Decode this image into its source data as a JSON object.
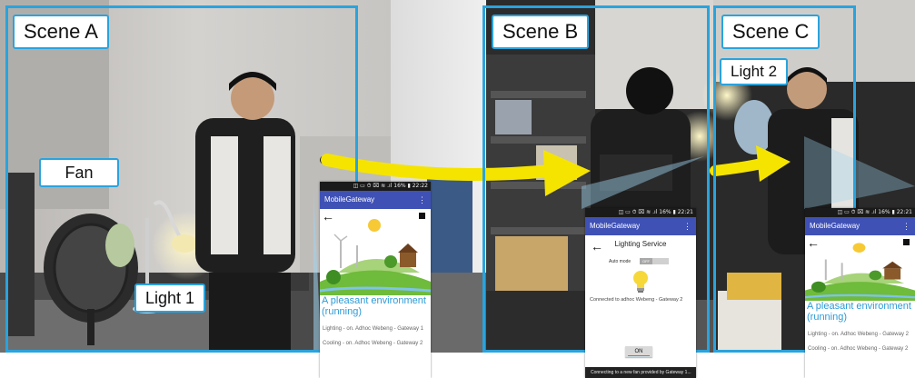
{
  "scenes": {
    "a": {
      "label": "Scene A"
    },
    "b": {
      "label": "Scene B"
    },
    "c": {
      "label": "Scene C"
    }
  },
  "callouts": {
    "fan": "Fan",
    "light1": "Light 1",
    "light2": "Light 2"
  },
  "colors": {
    "frame": "#2aa3dd",
    "arrow": "#f5e400",
    "appbar": "#3f51b5",
    "heading": "#2e9bd6"
  },
  "phones": {
    "a": {
      "status": "◫ ▭    ⏱ ⌧ ≋ .ıl 16% ▮ 22:22",
      "app_title": "MobileGateway",
      "menu_icon": "more-vertical-icon",
      "heading": "A pleasant environment (running)",
      "lines": [
        "Lighting - on. Adhoc Webeng - Gateway 1",
        "Cooling - on. Adhoc Webeng - Gateway 2"
      ]
    },
    "b": {
      "status": "◫ ▭    ⏱ ⌧ ≋ .ıl 16% ▮ 22:21",
      "app_title": "MobileGateway",
      "service_title": "Lighting Service",
      "auto_mode_label": "Auto mode",
      "auto_mode_value": "OFF",
      "connected_text": "Connected to adhoc Webeng - Gateway 2",
      "on_button": "ON",
      "toast": "Connecting to a new fan provided by Gateway 1..."
    },
    "c": {
      "status": "◫ ▭    ⏱ ⌧ ≋ .ıl 16% ▮ 22:21",
      "app_title": "MobileGateway",
      "heading": "A pleasant environment (running)",
      "lines": [
        "Lighting - on. Adhoc Webeng - Gateway 2",
        "Cooling - on. Adhoc Webeng - Gateway 2"
      ]
    }
  }
}
